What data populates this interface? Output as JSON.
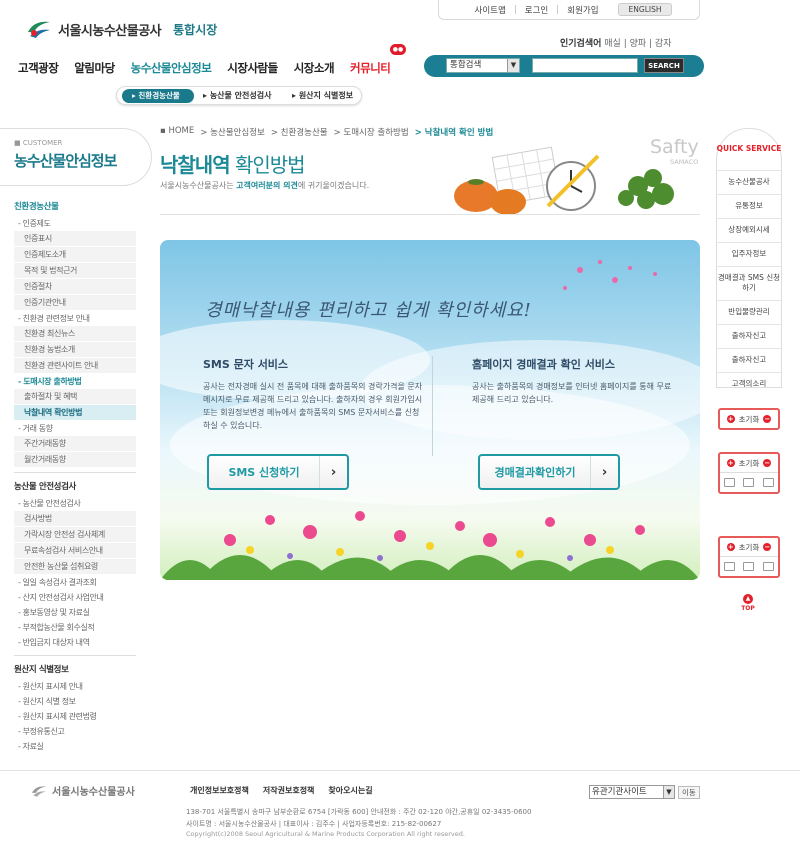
{
  "header": {
    "logo_text": "서울시농수산물공사",
    "logo_sub": "통합시장",
    "top_links": [
      "사이트맵",
      "로그인",
      "회원가입"
    ],
    "english_label": "ENGLISH",
    "popular_label": "인기검색어",
    "popular_terms": "매실 | 양파 | 감자",
    "gnb": [
      "고객광장",
      "알림마당",
      "농수산물안심정보",
      "시장사람들",
      "시장소개",
      "커뮤니티"
    ],
    "search_select": "통합검색",
    "search_button": "SEARCH",
    "subnav": [
      "친환경농산물",
      "농산물 안전성검사",
      "원산지 식별정보"
    ]
  },
  "sidebar": {
    "customer_label": "CUSTOMER",
    "title": "농수산물안심정보",
    "groups": [
      {
        "label": "친환경농산물",
        "items": [
          {
            "label": "- 인증제도",
            "type": "item"
          },
          {
            "label": "인증표시",
            "type": "sub"
          },
          {
            "label": "인증제도소개",
            "type": "sub"
          },
          {
            "label": "목적 및 법적근거",
            "type": "sub"
          },
          {
            "label": "인증절차",
            "type": "sub"
          },
          {
            "label": "인증기관안내",
            "type": "sub"
          },
          {
            "label": "- 친환경 관련정보 안내",
            "type": "item"
          },
          {
            "label": "친환경 최신뉴스",
            "type": "sub"
          },
          {
            "label": "친환경 농법소개",
            "type": "sub"
          },
          {
            "label": "친환경 관련사이트 안내",
            "type": "sub"
          },
          {
            "label": "- 도매시장 출하방법",
            "type": "item-on"
          },
          {
            "label": "출하절차 및 혜택",
            "type": "sub"
          },
          {
            "label": "낙찰내역 확인방법",
            "type": "sub-on"
          },
          {
            "label": "- 거래 동향",
            "type": "item"
          },
          {
            "label": "주간거래동향",
            "type": "sub"
          },
          {
            "label": "월간거래동향",
            "type": "sub"
          }
        ]
      },
      {
        "label": "농산물 안전성검사",
        "items": [
          {
            "label": "- 농산물 안전성검사",
            "type": "item"
          },
          {
            "label": "검사방법",
            "type": "sub"
          },
          {
            "label": "가락시장 안전성 검사체계",
            "type": "sub"
          },
          {
            "label": "무료속성검사 서비스안내",
            "type": "sub"
          },
          {
            "label": "안전한 농산물 섭취요령",
            "type": "sub"
          },
          {
            "label": "- 일일 속성검사 결과조회",
            "type": "item"
          },
          {
            "label": "- 산지 안전성검사 사업안내",
            "type": "item"
          },
          {
            "label": "- 홍보동영상 및 자료실",
            "type": "item"
          },
          {
            "label": "- 부적합농산물 회수실적",
            "type": "item"
          },
          {
            "label": "- 반입금지 대상자 내역",
            "type": "item"
          }
        ]
      },
      {
        "label": "원산지 식별정보",
        "items": [
          {
            "label": "- 원산지 표시제 안내",
            "type": "item"
          },
          {
            "label": "- 원산지 식별 정보",
            "type": "item"
          },
          {
            "label": "- 원산지 표시제 관련법령",
            "type": "item"
          },
          {
            "label": "- 부정유통신고",
            "type": "item"
          },
          {
            "label": "- 자료실",
            "type": "item"
          }
        ]
      }
    ]
  },
  "content": {
    "breadcrumb": [
      "HOME",
      "농산물안심정보",
      "친환경농산물",
      "도매시장 출하방법",
      "낙찰내역 확인 방법"
    ],
    "title_bold": "낙찰내역",
    "title_rest": " 확인방법",
    "desc_pre": "서울시농수산물공사는 ",
    "desc_bold": "고객여러분의 의견",
    "desc_post": "에 귀기울이겠습니다.",
    "deco_big": "Safty",
    "deco_small": "SAMACO",
    "slogan": "경매낙찰내용 편리하고 쉽게 확인하세요!",
    "sms_title": "SMS 문자 서비스",
    "sms_desc": "공사는 전자경매 실시 전 품목에 대해 출하품목의 경락가격을 문자 메시지로 무료 제공해 드리고 있습니다. 출하자의 경우 회원가입시 또는 회원정보변경 메뉴에서 출하품목의 SMS 문자서비스를 신청하실 수 있습니다.",
    "sms_button": "SMS 신청하기",
    "web_title": "홈페이지 경매결과 확인 서비스",
    "web_desc": "공사는 출하품목의 경매정보를 인터넷 홈페이지를 통해 무료 제공해 드리고 있습니다.",
    "web_button": "경매결과확인하기"
  },
  "quick": {
    "head": "QUICK SERVICE",
    "items": [
      "농수산물공사",
      "유통정보",
      "상장예외시세",
      "입주자정보",
      "경매결과 SMS 신청하기",
      "반입물량관리",
      "출하자신고",
      "출하자신고",
      "고객의소리"
    ],
    "reset_label": "초기화",
    "top_label": "TOP"
  },
  "footer": {
    "logo_text": "서울시농수산물공사",
    "links": [
      "개인정보보호정책",
      "저작권보호정책",
      "찾아오시는길"
    ],
    "select_label": "유관기관사이트",
    "go_label": "이동",
    "address": "138-701 서울특별시 송파구 남부순환로 6754 [가락동 600] 안내전화 : 주간 02-120  야간,공휴일 02-3435-0600",
    "info": "사이트명 : 서울시농수산물공사  |  대표이사 : 김주수  |  사업자등록번호: 215-82-00627",
    "copyright": "Copyright(c)2008 Seoul Agricultural & Marine Products Corporation All right reserved."
  },
  "colors": {
    "accent": "#1c8a96",
    "brand_red": "#e5202a",
    "nav_bar": "#1b7e93"
  }
}
